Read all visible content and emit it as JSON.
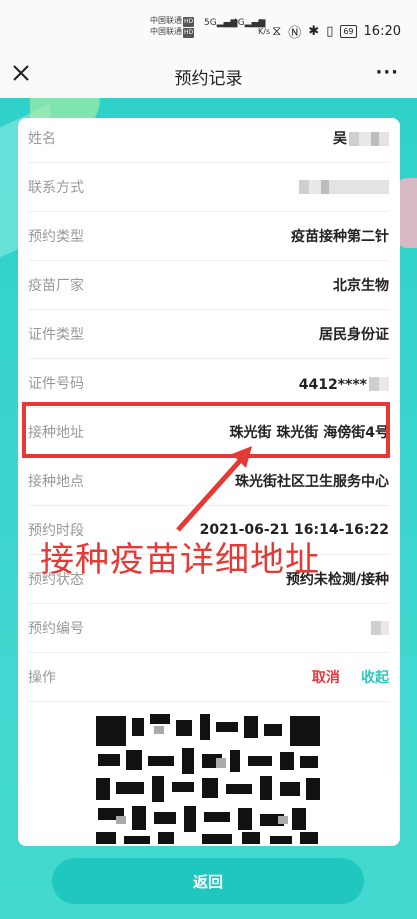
{
  "status_bar": {
    "carrier1": "中国联通",
    "carrier2": "中国联通",
    "hd": "HD",
    "sig1": "5G",
    "sig2": "4G",
    "speed": "0\nK/s",
    "battery": "69",
    "time": "16:20"
  },
  "header": {
    "title": "预约记录",
    "more": "···"
  },
  "record": {
    "rows": [
      {
        "label": "姓名",
        "value": "吴"
      },
      {
        "label": "联系方式",
        "value": ""
      },
      {
        "label": "预约类型",
        "value": "疫苗接种第二针"
      },
      {
        "label": "疫苗厂家",
        "value": "北京生物"
      },
      {
        "label": "证件类型",
        "value": "居民身份证"
      },
      {
        "label": "证件号码",
        "value": "4412****"
      },
      {
        "label": "接种地址",
        "value": "珠光街 珠光街 海傍街4号"
      },
      {
        "label": "接种地点",
        "value": "珠光街社区卫生服务中心"
      },
      {
        "label": "预约时段",
        "value": "2021-06-21 16:14-16:22"
      },
      {
        "label": "预约状态",
        "value": "预约未检测/接种"
      },
      {
        "label": "预约编号",
        "value": ""
      },
      {
        "label": "操作",
        "value": ""
      }
    ],
    "action_cancel": "取消",
    "action_collapse": "收起"
  },
  "annotation": {
    "text": "接种疫苗详细地址",
    "color": "#e53935"
  },
  "footer": {
    "return_label": "返回"
  },
  "colors": {
    "accent": "#1fc7bf",
    "danger": "#e4393c"
  }
}
